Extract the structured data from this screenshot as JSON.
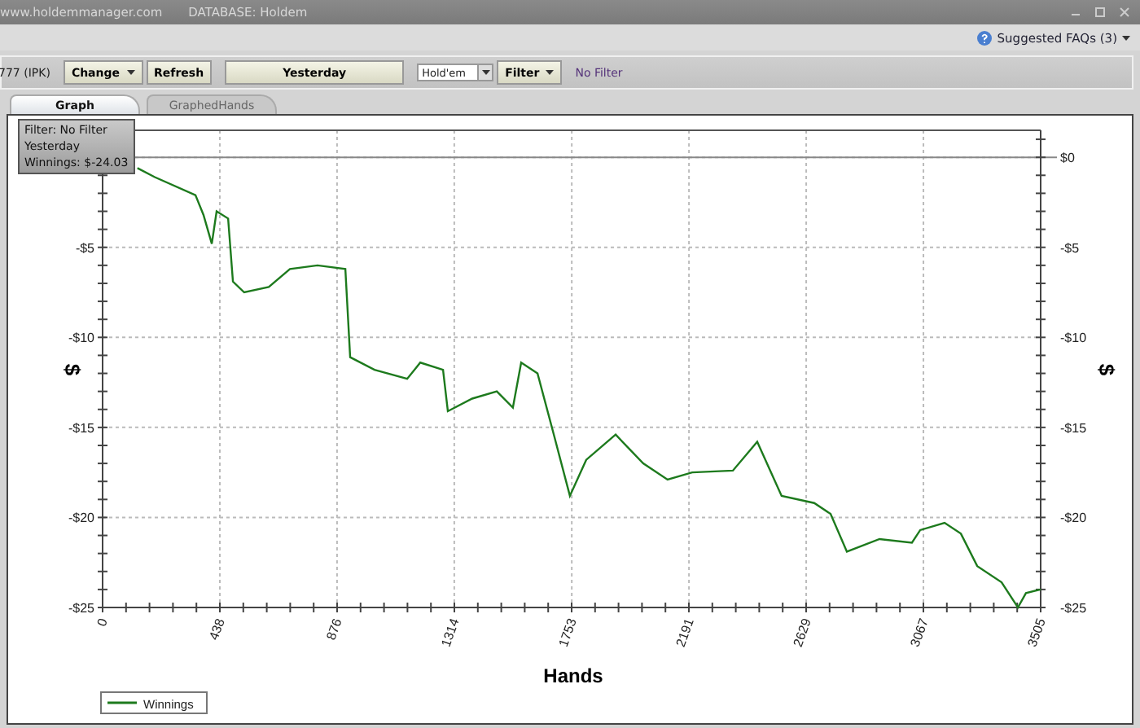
{
  "window": {
    "url": "www.holdemmanager.com",
    "database": "DATABASE: Holdem"
  },
  "help": {
    "faq_link": "Suggested FAQs (3)"
  },
  "toolbar": [
    {
      "kind": "text",
      "label": "777 (IPK)"
    },
    {
      "kind": "dropdown",
      "label": "Change"
    },
    {
      "kind": "button",
      "label": "Refresh"
    },
    {
      "kind": "wide",
      "label": "Yesterday"
    },
    {
      "kind": "select",
      "label": "Hold'em"
    },
    {
      "kind": "dropdown",
      "label": "Filter"
    },
    {
      "kind": "status",
      "label": "No Filter"
    }
  ],
  "tabs": [
    {
      "label": "Graph",
      "selected": true
    },
    {
      "label": "GraphedHands",
      "selected": false
    }
  ],
  "tooltip": [
    "Filter: No Filter",
    "Yesterday",
    "Winnings: $-24.03"
  ],
  "chart_data": {
    "type": "line",
    "xlabel": "Hands",
    "ylabel": "$",
    "y2label": "$",
    "x": [
      130,
      195,
      347,
      377,
      408,
      426,
      469,
      487,
      529,
      621,
      700,
      803,
      907,
      925,
      1016,
      1138,
      1187,
      1272,
      1290,
      1381,
      1473,
      1533,
      1564,
      1625,
      1686,
      1746,
      1807,
      1917,
      2020,
      2111,
      2203,
      2355,
      2446,
      2537,
      2659,
      2720,
      2781,
      2903,
      3024,
      3055,
      3146,
      3207,
      3268,
      3359,
      3420,
      3450,
      3505
    ],
    "series": [
      {
        "name": "Winnings",
        "color": "#1d7a1d",
        "values": [
          -0.6,
          -1.1,
          -2.1,
          -3.2,
          -4.8,
          -3,
          -3.4,
          -6.9,
          -7.5,
          -7.2,
          -6.2,
          -6,
          -6.2,
          -11.1,
          -11.8,
          -12.3,
          -11.4,
          -11.8,
          -14.1,
          -13.4,
          -13,
          -13.9,
          -11.4,
          -12,
          -15.4,
          -18.8,
          -16.8,
          -15.4,
          -17,
          -17.9,
          -17.5,
          -17.4,
          -15.8,
          -18.8,
          -19.2,
          -19.8,
          -21.9,
          -21.2,
          -21.4,
          -20.7,
          -20.3,
          -20.9,
          -22.7,
          -23.6,
          -25,
          -24.2,
          -24
        ]
      }
    ],
    "grid": true,
    "xlim": [
      0,
      3505
    ],
    "ylim": [
      -25,
      1.5
    ],
    "xticks": [
      0,
      438,
      876,
      1314,
      1753,
      2191,
      2629,
      3067,
      3505
    ],
    "yticks": [
      {
        "value": 0,
        "label": "$0"
      },
      {
        "value": -5,
        "label": "-$5"
      },
      {
        "value": -10,
        "label": "-$10"
      },
      {
        "value": -15,
        "label": "-$15"
      },
      {
        "value": -20,
        "label": "-$20"
      },
      {
        "value": -25,
        "label": "-$25"
      }
    ]
  }
}
